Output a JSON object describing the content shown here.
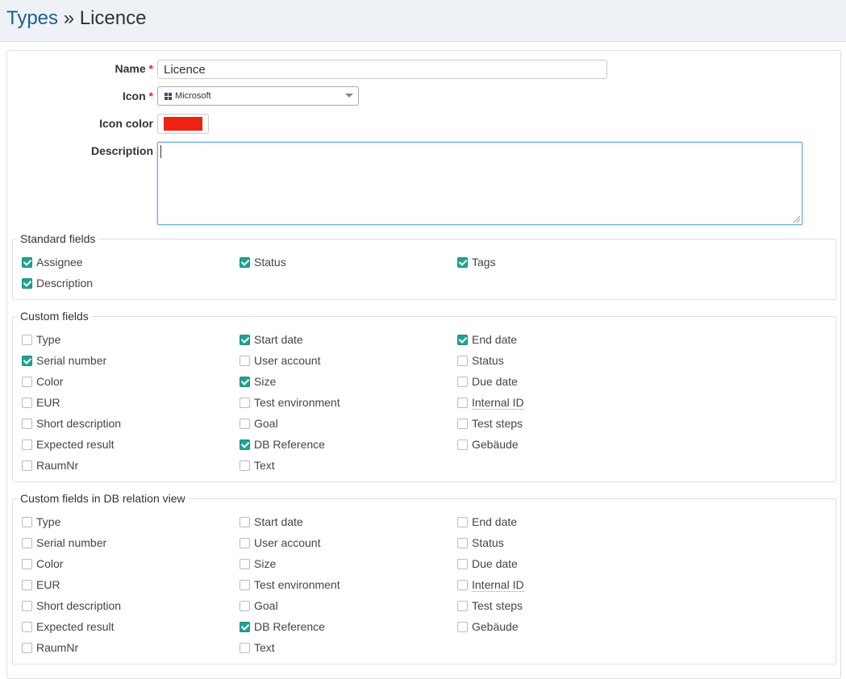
{
  "breadcrumb": {
    "parent": "Types",
    "separator": "»",
    "current": "Licence"
  },
  "form": {
    "name_label": "Name",
    "name_value": "Licence",
    "icon_label": "Icon",
    "icon_value": "Microsoft",
    "icon_color_label": "Icon color",
    "icon_color_value": "#ee2211",
    "description_label": "Description",
    "description_value": "",
    "required_mark": "*"
  },
  "standard_fields": {
    "title": "Standard fields",
    "items": [
      {
        "label": "Assignee",
        "checked": true
      },
      {
        "label": "Status",
        "checked": true
      },
      {
        "label": "Tags",
        "checked": true
      },
      {
        "label": "Description",
        "checked": true
      }
    ]
  },
  "custom_fields": {
    "title": "Custom fields",
    "items": [
      {
        "label": "Type",
        "checked": false
      },
      {
        "label": "Start date",
        "checked": true
      },
      {
        "label": "End date",
        "checked": true
      },
      {
        "label": "Serial number",
        "checked": true
      },
      {
        "label": "User account",
        "checked": false
      },
      {
        "label": "Status",
        "checked": false
      },
      {
        "label": "Color",
        "checked": false
      },
      {
        "label": "Size",
        "checked": true
      },
      {
        "label": "Due date",
        "checked": false
      },
      {
        "label": "EUR",
        "checked": false
      },
      {
        "label": "Test environment",
        "checked": false
      },
      {
        "label": "Internal ID",
        "checked": false
      },
      {
        "label": "Short description",
        "checked": false
      },
      {
        "label": "Goal",
        "checked": false
      },
      {
        "label": "Test steps",
        "checked": false
      },
      {
        "label": "Expected result",
        "checked": false
      },
      {
        "label": "DB Reference",
        "checked": true
      },
      {
        "label": "Gebäude",
        "checked": false
      },
      {
        "label": "RaumNr",
        "checked": false
      },
      {
        "label": "Text",
        "checked": false
      }
    ]
  },
  "custom_fields_relation": {
    "title": "Custom fields in DB relation view",
    "items": [
      {
        "label": "Type",
        "checked": false
      },
      {
        "label": "Start date",
        "checked": false
      },
      {
        "label": "End date",
        "checked": false
      },
      {
        "label": "Serial number",
        "checked": false
      },
      {
        "label": "User account",
        "checked": false
      },
      {
        "label": "Status",
        "checked": false
      },
      {
        "label": "Color",
        "checked": false
      },
      {
        "label": "Size",
        "checked": false
      },
      {
        "label": "Due date",
        "checked": false
      },
      {
        "label": "EUR",
        "checked": false
      },
      {
        "label": "Test environment",
        "checked": false
      },
      {
        "label": "Internal ID",
        "checked": false
      },
      {
        "label": "Short description",
        "checked": false
      },
      {
        "label": "Goal",
        "checked": false
      },
      {
        "label": "Test steps",
        "checked": false
      },
      {
        "label": "Expected result",
        "checked": false
      },
      {
        "label": "DB Reference",
        "checked": true
      },
      {
        "label": "Gebäude",
        "checked": false
      },
      {
        "label": "RaumNr",
        "checked": false
      },
      {
        "label": "Text",
        "checked": false
      }
    ]
  },
  "colors": {
    "accent": "#21a393",
    "link": "#1f5f8b",
    "required": "#c9302c"
  }
}
